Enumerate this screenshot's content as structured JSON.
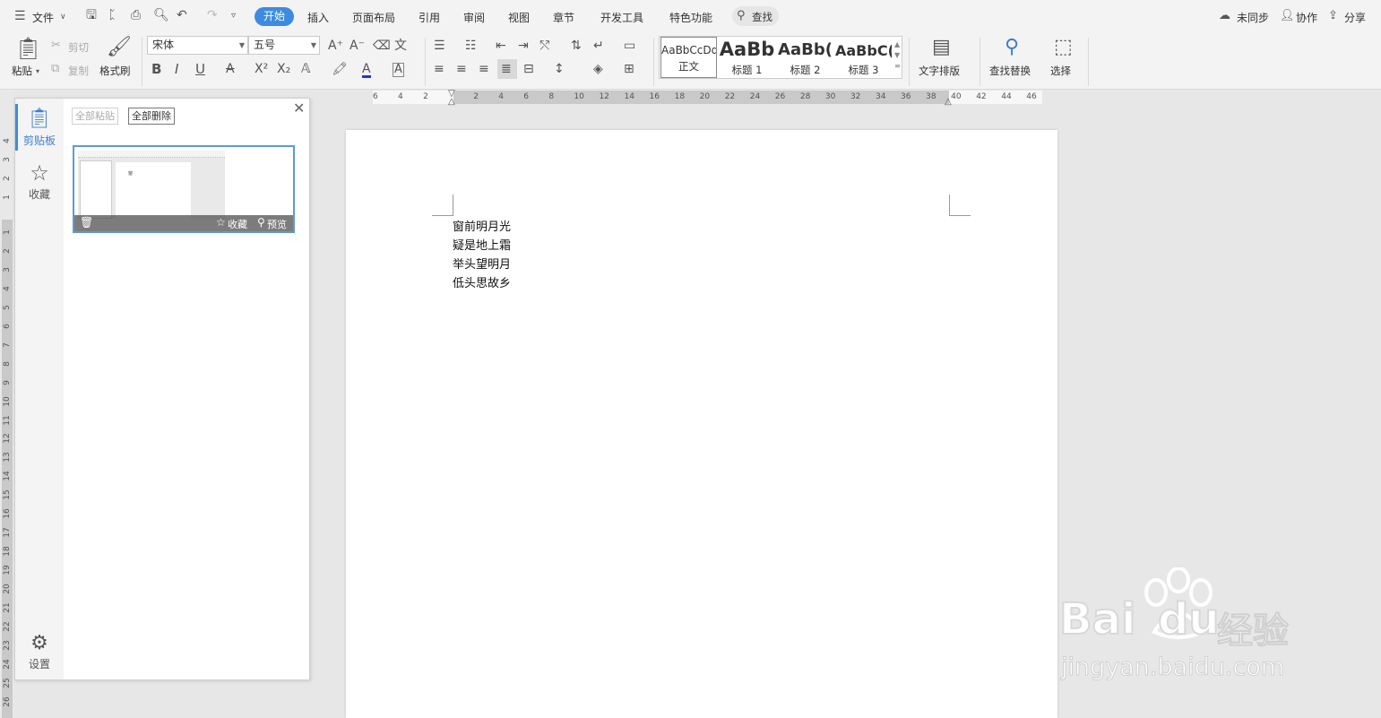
{
  "menubar": {
    "file": "文件",
    "tabs": [
      "开始",
      "插入",
      "页面布局",
      "引用",
      "审阅",
      "视图",
      "章节",
      "开发工具",
      "特色功能"
    ],
    "search": "查找",
    "sync": "未同步",
    "collab": "协作",
    "share": "分享"
  },
  "ribbon": {
    "paste": "粘贴",
    "cut": "剪切",
    "copy": "复制",
    "format_painter": "格式刷",
    "font_name": "宋体",
    "font_size": "五号",
    "styles": [
      {
        "preview": "AaBbCcDd",
        "label": "正文"
      },
      {
        "preview": "AaBb",
        "label": "标题 1"
      },
      {
        "preview": "AaBb(",
        "label": "标题 2"
      },
      {
        "preview": "AaBbC(",
        "label": "标题 3"
      }
    ],
    "text_layout": "文字排版",
    "find_replace": "查找替换",
    "select": "选择"
  },
  "ruler": {
    "h_numbers": [
      "6",
      "4",
      "2",
      "2",
      "4",
      "6",
      "8",
      "10",
      "12",
      "14",
      "16",
      "18",
      "20",
      "22",
      "24",
      "26",
      "28",
      "30",
      "32",
      "34",
      "36",
      "38",
      "40",
      "42",
      "44",
      "46"
    ],
    "v_numbers": [
      "4",
      "3",
      "2",
      "1",
      "1",
      "2",
      "3",
      "4",
      "5",
      "6",
      "7",
      "8",
      "9",
      "10",
      "11",
      "12",
      "13",
      "14",
      "15",
      "16",
      "17",
      "18",
      "19",
      "20",
      "21",
      "22",
      "23",
      "24",
      "25",
      "26"
    ]
  },
  "clipboard_panel": {
    "tab_clipboard": "剪贴板",
    "tab_favorites": "收藏",
    "settings": "设置",
    "paste_all": "全部粘贴",
    "delete_all": "全部删除",
    "item_favorite": "收藏",
    "item_preview": "预览",
    "thumb_text": "窗"
  },
  "document": {
    "lines": [
      "窗前明月光",
      "疑是地上霜",
      "举头望明月",
      "低头思故乡"
    ]
  },
  "watermark": {
    "brand": "Bai",
    "brand2": "du",
    "cn": "经验",
    "url": "jingyan.baidu.com"
  }
}
